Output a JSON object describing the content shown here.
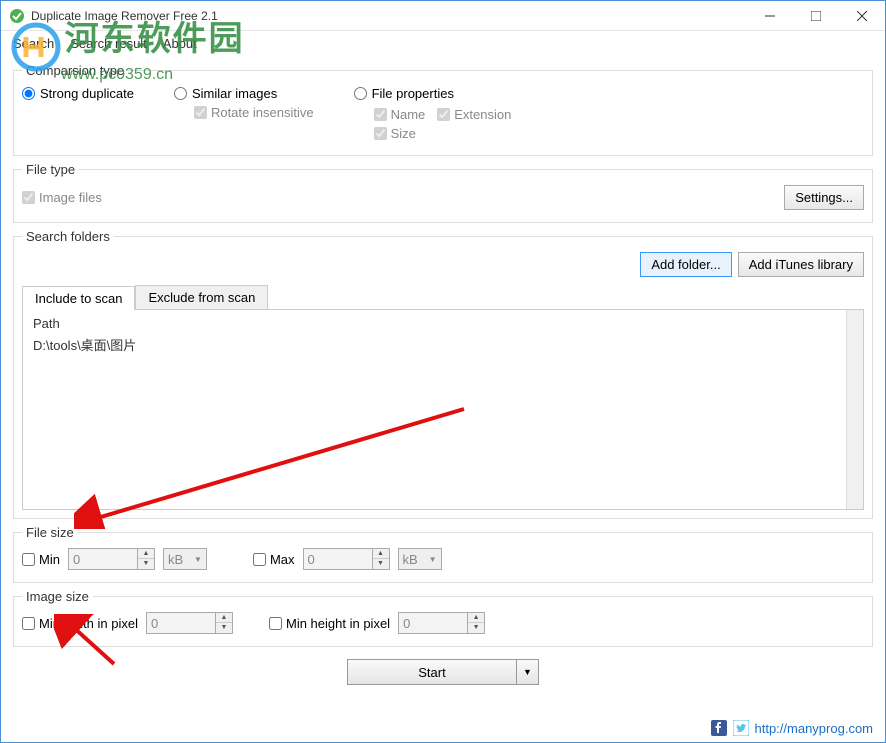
{
  "window": {
    "title": "Duplicate Image Remover Free 2.1"
  },
  "menu": {
    "search": "Search",
    "search_result": "Search result",
    "about": "About"
  },
  "watermark": {
    "text": "河东软件园",
    "url": "www.pc0359.cn"
  },
  "comparison": {
    "legend": "Comparsion type",
    "strong": "Strong duplicate",
    "similar": "Similar images",
    "rotate": "Rotate insensitive",
    "fileprops": "File properties",
    "name": "Name",
    "extension": "Extension",
    "size": "Size"
  },
  "filetype": {
    "legend": "File type",
    "image_files": "Image files",
    "settings": "Settings..."
  },
  "folders": {
    "legend": "Search folders",
    "add_folder": "Add folder...",
    "add_itunes": "Add iTunes library",
    "tab_include": "Include to scan",
    "tab_exclude": "Exclude from scan",
    "path_header": "Path",
    "path_entry": "D:\\tools\\桌面\\图片"
  },
  "filesize": {
    "legend": "File size",
    "min": "Min",
    "max": "Max",
    "min_value": "0",
    "max_value": "0",
    "unit": "kB"
  },
  "imagesize": {
    "legend": "Image size",
    "min_width": "Min width in pixel",
    "min_height": "Min height in pixel",
    "min_width_value": "0",
    "min_height_value": "0"
  },
  "start": {
    "label": "Start"
  },
  "footer": {
    "link": "http://manyprog.com"
  }
}
